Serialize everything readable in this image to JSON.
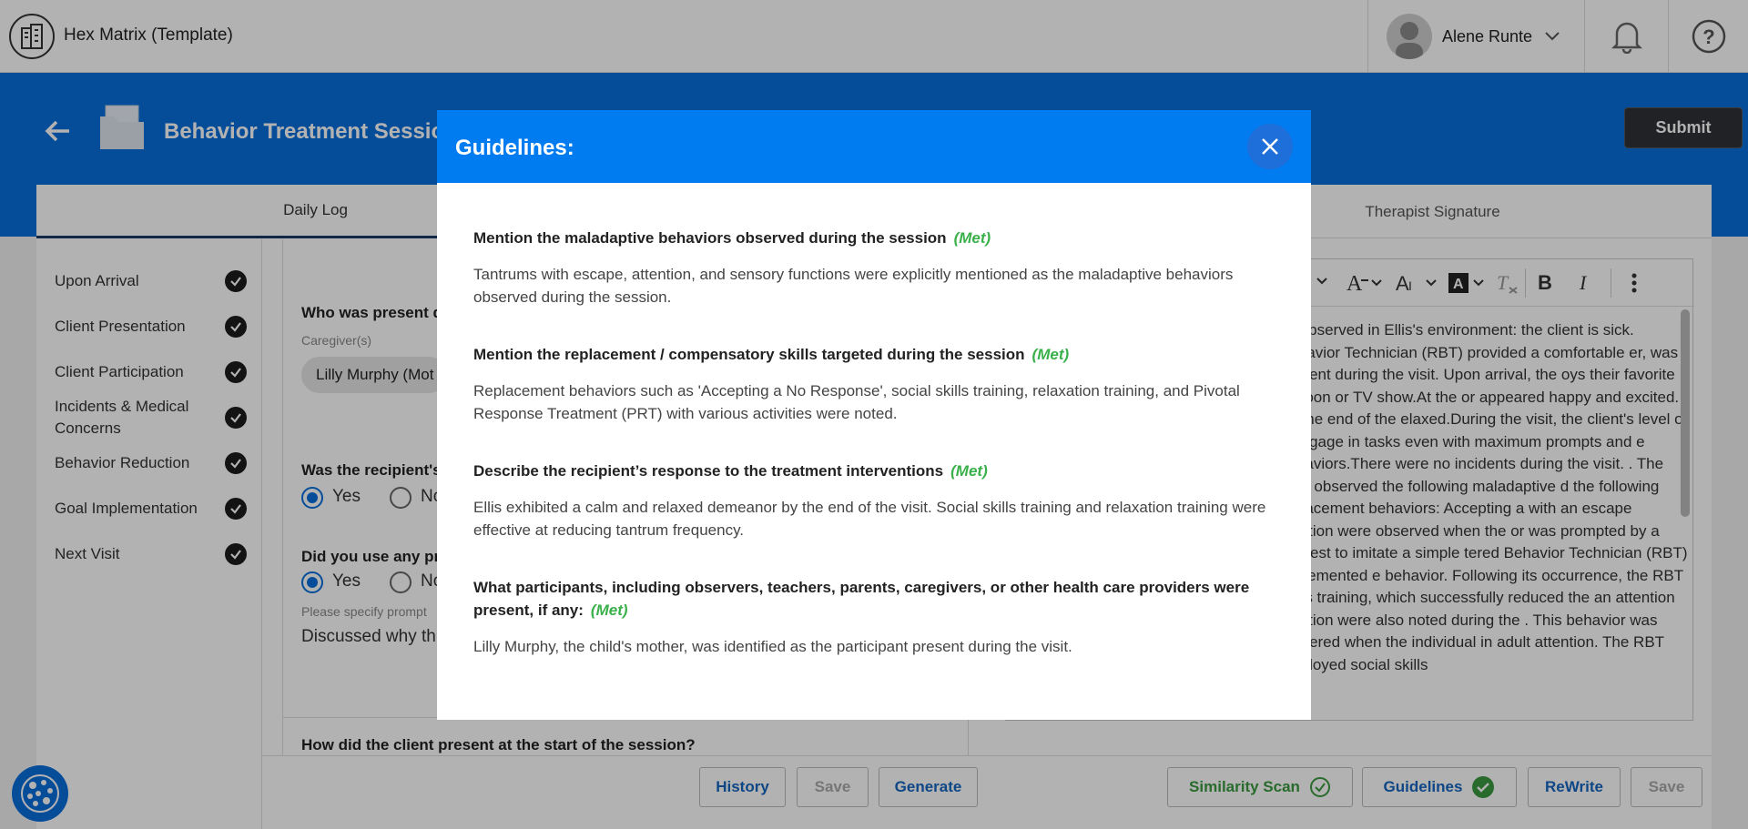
{
  "app": {
    "title": "Hex Matrix (Template)",
    "user_name": "Alene Runte"
  },
  "header": {
    "page_title": "Behavior Treatment Session",
    "submit_label": "Submit"
  },
  "tabs": [
    {
      "label": "Daily Log"
    },
    {
      "label": "Therapist Signature"
    }
  ],
  "sidebar": {
    "items": [
      {
        "label": "Upon Arrival"
      },
      {
        "label": "Client Presentation"
      },
      {
        "label": "Client Participation"
      },
      {
        "label": "Incidents & Medical Concerns"
      },
      {
        "label": "Behavior Reduction"
      },
      {
        "label": "Goal Implementation"
      },
      {
        "label": "Next Visit"
      }
    ]
  },
  "form": {
    "q1": "Who was present du",
    "caregivers_label": "Caregiver(s)",
    "chip": "Lilly Murphy (Mot",
    "q2": "Was the recipient's",
    "q3": "Did you use any pro",
    "yes": "Yes",
    "no": "No",
    "prompt_label": "Please specify prompt",
    "prompt_value": "Discussed why th",
    "q4": "How did the client present at the start of the session?"
  },
  "left_buttons": {
    "history": "History",
    "save": "Save",
    "generate": "Generate"
  },
  "editor": {
    "text": "as observed in Ellis's environment: the client is sick. Behavior Technician (RBT) provided a comfortable er, was present during the visit. Upon arrival, the oys their favorite cartoon or TV show.At the or appeared happy and excited. By the end of the elaxed.During the visit, the client's level of o engage in tasks even with maximum prompts and e behaviors.There were no incidents during the visit. . The RBT observed the following maladaptive d the following replacement behaviors: Accepting a with an escape function were observed when the or was prompted by a request to imitate a simple tered Behavior Technician (RBT) implemented e behavior. Following its occurrence, the RBT skills training, which successfully reduced the an attention function were also noted during the . This behavior was triggered when the individual in adult attention. The RBT employed social skills"
  },
  "right_buttons": {
    "similarity": "Similarity Scan",
    "guidelines": "Guidelines",
    "rewrite": "ReWrite",
    "save": "Save"
  },
  "modal": {
    "title": "Guidelines:",
    "items": [
      {
        "question": "Mention the maladaptive behaviors observed during the session",
        "status": "(Met)",
        "answer": "Tantrums with escape, attention, and sensory functions were explicitly mentioned as the maladaptive behaviors observed during the session."
      },
      {
        "question": "Mention the replacement / compensatory skills targeted during the session",
        "status": "(Met)",
        "answer": "Replacement behaviors such as 'Accepting a No Response', social skills training, relaxation training, and Pivotal Response Treatment (PRT) with various activities were noted."
      },
      {
        "question": "Describe the recipient’s response to the treatment interventions",
        "status": "(Met)",
        "answer": "Ellis exhibited a calm and relaxed demeanor by the end of the visit. Social skills training and relaxation training were effective at reducing tantrum frequency."
      },
      {
        "question": "What participants, including observers, teachers, parents, caregivers, or other health care providers were present, if any:",
        "status": "(Met)",
        "answer": "Lilly Murphy, the child's mother, was identified as the participant present during the visit."
      }
    ]
  },
  "colors": {
    "brand_blue": "#0a6fdc",
    "modal_header": "#007bf0",
    "met_green": "#3ab04a"
  }
}
